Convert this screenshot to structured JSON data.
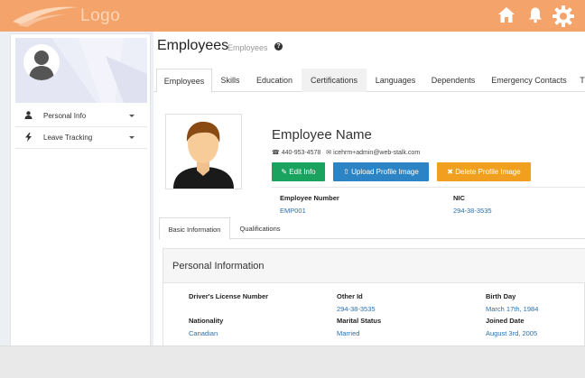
{
  "topbar": {
    "logo_text": "Logo",
    "icons": [
      "home-icon",
      "bell-icon",
      "gear-icon"
    ],
    "color": "#f4a36a"
  },
  "sidebar": {
    "items": [
      {
        "label": "Personal Info",
        "icon": "user-icon"
      },
      {
        "label": "Leave Tracking",
        "icon": "bolt-icon"
      }
    ]
  },
  "main": {
    "title": "Employees",
    "subtitle": "Employees",
    "tabs": [
      "Employees",
      "Skills",
      "Education",
      "Certifications",
      "Languages",
      "Dependents",
      "Emergency Contacts",
      "T"
    ]
  },
  "employee": {
    "name": "Employee Name",
    "phone": "440-953-4578",
    "email": "icehrm+admin@web-stalk.com",
    "buttons": {
      "edit": "Edit Info",
      "upload": "Upload Profile Image",
      "delete": "Delete Profile Image"
    },
    "employee_number_label": "Employee Number",
    "employee_number": "EMP001",
    "nic_label": "NIC",
    "nic": "294-38-3535"
  },
  "subtabs": [
    "Basic Information",
    "Qualifications"
  ],
  "personal_info": {
    "title": "Personal Information",
    "fields": [
      {
        "label": "Driver's License Number",
        "value": ""
      },
      {
        "label": "Other Id",
        "value": "294-38-3535"
      },
      {
        "label": "Birth Day",
        "value": "March 17th, 1984"
      },
      {
        "label": "Nationality",
        "value": "Canadian"
      },
      {
        "label": "Marital Status",
        "value": "Married"
      },
      {
        "label": "Joined Date",
        "value": "August 3rd, 2005"
      }
    ]
  },
  "colors": {
    "accent": "#f4a36a",
    "green": "#1aa25f",
    "blue": "#2d84c5",
    "orange": "#f0a01e",
    "link": "#2a6fb0"
  }
}
